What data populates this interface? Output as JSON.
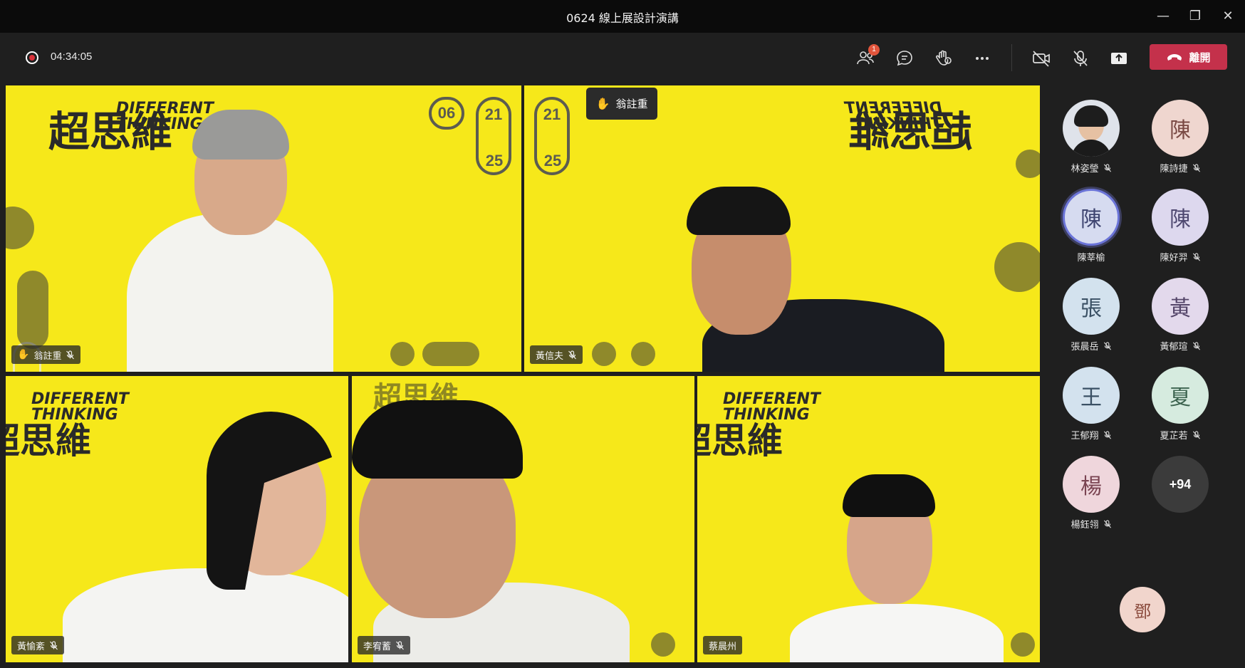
{
  "window": {
    "title": "0624 線上展設計演講",
    "minimize": "—",
    "restore": "❐",
    "close": "✕"
  },
  "toolbar": {
    "timer": "04:34:05",
    "participants_badge": "1",
    "leave_label": "離開"
  },
  "brand": {
    "en_line1": "DIFFERENT",
    "en_line2": "THINKING",
    "zh": "超思維",
    "date_a": "06",
    "date_b": "21",
    "date_c": "25"
  },
  "raised_hand_popup": "翁註重",
  "tiles": [
    {
      "name": "翁註重",
      "hand_raised": true,
      "muted": true
    },
    {
      "name": "黃信夫",
      "hand_raised": false,
      "muted": true
    },
    {
      "name": "黃愉紊",
      "hand_raised": false,
      "muted": true
    },
    {
      "name": "李宥蓄",
      "hand_raised": false,
      "muted": true
    },
    {
      "name": "蔡晨州",
      "hand_raised": false,
      "muted": false
    }
  ],
  "roster": [
    {
      "initial": "",
      "name": "林姿瑩",
      "muted": true,
      "photo": true
    },
    {
      "initial": "陳",
      "name": "陳詩捷",
      "muted": true
    },
    {
      "initial": "陳",
      "name": "陳莘榆",
      "muted": false,
      "speaking": true
    },
    {
      "initial": "陳",
      "name": "陳好羿",
      "muted": true
    },
    {
      "initial": "張",
      "name": "張晨岳",
      "muted": true
    },
    {
      "initial": "黃",
      "name": "黃郁瑄",
      "muted": true
    },
    {
      "initial": "王",
      "name": "王郁翔",
      "muted": true
    },
    {
      "initial": "夏",
      "name": "夏芷若",
      "muted": true
    },
    {
      "initial": "楊",
      "name": "楊鈺翎",
      "muted": true
    },
    {
      "initial": "+94",
      "name": "",
      "more": true
    }
  ],
  "self_avatar": "鄧",
  "colors": {
    "accent_leave": "#c4314b",
    "tile_bg": "#f6e81a",
    "app_bg": "#1f1f1f"
  }
}
